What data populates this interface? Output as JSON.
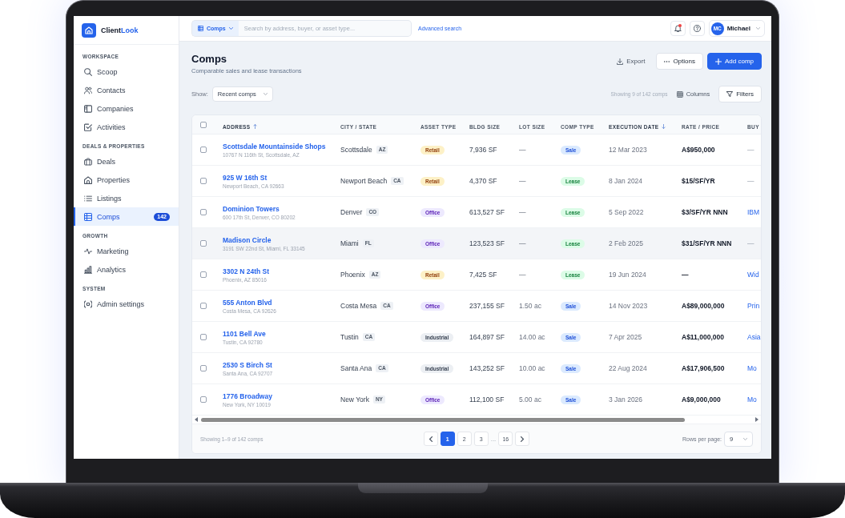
{
  "sidebar": {
    "brand": {
      "first": "Client",
      "second": "Look"
    },
    "sections": [
      {
        "title": "WORKSPACE",
        "items": [
          {
            "label": "Scoop",
            "selected": false
          },
          {
            "label": "Contacts",
            "selected": false
          },
          {
            "label": "Companies",
            "selected": false
          },
          {
            "label": "Activities",
            "selected": false
          }
        ]
      },
      {
        "title": "DEALS & PROPERTIES",
        "items": [
          {
            "label": "Deals",
            "selected": false
          },
          {
            "label": "Properties",
            "selected": false
          },
          {
            "label": "Listings",
            "selected": false
          },
          {
            "label": "Comps",
            "selected": true,
            "badge": "142"
          }
        ]
      },
      {
        "title": "GROWTH",
        "items": [
          {
            "label": "Marketing",
            "selected": false
          },
          {
            "label": "Analytics",
            "selected": false
          }
        ]
      },
      {
        "title": "SYSTEM",
        "items": [
          {
            "label": "Admin settings",
            "selected": false
          }
        ]
      }
    ]
  },
  "topbar": {
    "scope": "Comps",
    "search": {
      "placeholder": "Search by address, buyer, or asset type..."
    },
    "advanced_search": "Advanced search",
    "notifications_unread": true,
    "user": {
      "initials": "MC",
      "name": "Michael"
    }
  },
  "page": {
    "title": "Comps",
    "subtitle": "Comparable sales and lease transactions",
    "actions": [
      {
        "label": "Export",
        "kind": "link"
      },
      {
        "label": "Options",
        "kind": "secondary"
      },
      {
        "label": "Add comp",
        "kind": "primary"
      }
    ],
    "toolbar": {
      "show_label": "Show:",
      "view": "Recent comps",
      "count": "Showing 9 of 142 comps",
      "columns": "Columns",
      "filters": "Filters"
    }
  },
  "table": {
    "select_all_checked": false,
    "columns": [
      {
        "label": "ADDRESS",
        "sort_asc": true,
        "sort_desc": false
      },
      {
        "label": "CITY / STATE",
        "sort_asc": false,
        "sort_desc": false
      },
      {
        "label": "ASSET TYPE",
        "sort_asc": false,
        "sort_desc": false
      },
      {
        "label": "BLDG SIZE",
        "sort_asc": false,
        "sort_desc": false
      },
      {
        "label": "LOT SIZE",
        "sort_asc": false,
        "sort_desc": false
      },
      {
        "label": "COMP TYPE",
        "sort_asc": false,
        "sort_desc": false
      },
      {
        "label": "EXECUTION DATE",
        "sort_asc": false,
        "sort_desc": true
      },
      {
        "label": "RATE / PRICE",
        "sort_asc": false,
        "sort_desc": false
      },
      {
        "label": "BUY",
        "sort_asc": false,
        "sort_desc": false
      }
    ],
    "rows": [
      {
        "name": "Scottsdale Mountainside Shops",
        "address": "10767 N 116th St, Scottsdale, AZ",
        "city": "Scottsdale",
        "state": "AZ",
        "asset_type": {
          "label": "Retail",
          "kind": "retail"
        },
        "bldg_size": "7,936 SF",
        "lot_size": "—",
        "comp_type": {
          "label": "Sale",
          "kind": "sale"
        },
        "execution_date": "12 Mar 2023",
        "rate_price": "A$950,000",
        "buyer": {
          "text": "—",
          "link": false
        },
        "checked": false,
        "hovered": false
      },
      {
        "name": "925 W 16th St",
        "address": "Newport Beach, CA 92663",
        "city": "Newport Beach",
        "state": "CA",
        "asset_type": {
          "label": "Retail",
          "kind": "retail"
        },
        "bldg_size": "4,370 SF",
        "lot_size": "—",
        "comp_type": {
          "label": "Lease",
          "kind": "lease"
        },
        "execution_date": "8 Jan 2024",
        "rate_price": "$15/SF/YR",
        "buyer": {
          "text": "—",
          "link": false
        },
        "checked": false,
        "hovered": false
      },
      {
        "name": "Dominion Towers",
        "address": "600 17th St, Denver, CO 80202",
        "city": "Denver",
        "state": "CO",
        "asset_type": {
          "label": "Office",
          "kind": "office"
        },
        "bldg_size": "613,527 SF",
        "lot_size": "—",
        "comp_type": {
          "label": "Lease",
          "kind": "lease"
        },
        "execution_date": "5 Sep 2022",
        "rate_price": "$3/SF/YR NNN",
        "buyer": {
          "text": "IBM",
          "link": true
        },
        "checked": false,
        "hovered": false
      },
      {
        "name": "Madison Circle",
        "address": "3191 SW 22nd St, Miami, FL 33145",
        "city": "Miami",
        "state": "FL",
        "asset_type": {
          "label": "Office",
          "kind": "office"
        },
        "bldg_size": "123,523 SF",
        "lot_size": "—",
        "comp_type": {
          "label": "Lease",
          "kind": "lease"
        },
        "execution_date": "2 Feb 2025",
        "rate_price": "$31/SF/YR NNN",
        "buyer": {
          "text": "—",
          "link": false
        },
        "checked": false,
        "hovered": true
      },
      {
        "name": "3302 N 24th St",
        "address": "Phoenix, AZ 85016",
        "city": "Phoenix",
        "state": "AZ",
        "asset_type": {
          "label": "Retail",
          "kind": "retail"
        },
        "bldg_size": "7,425 SF",
        "lot_size": "—",
        "comp_type": {
          "label": "Lease",
          "kind": "lease"
        },
        "execution_date": "19 Jun 2024",
        "rate_price": "—",
        "buyer": {
          "text": "Wid",
          "link": true
        },
        "checked": false,
        "hovered": false
      },
      {
        "name": "555 Anton Blvd",
        "address": "Costa Mesa, CA 92626",
        "city": "Costa Mesa",
        "state": "CA",
        "asset_type": {
          "label": "Office",
          "kind": "office"
        },
        "bldg_size": "237,155 SF",
        "lot_size": "1.50 ac",
        "comp_type": {
          "label": "Sale",
          "kind": "sale"
        },
        "execution_date": "14 Nov 2023",
        "rate_price": "A$89,000,000",
        "buyer": {
          "text": "Prin",
          "link": true
        },
        "checked": false,
        "hovered": false
      },
      {
        "name": "1101 Bell Ave",
        "address": "Tustin, CA 92780",
        "city": "Tustin",
        "state": "CA",
        "asset_type": {
          "label": "Industrial",
          "kind": "industrial"
        },
        "bldg_size": "164,897 SF",
        "lot_size": "14.00 ac",
        "comp_type": {
          "label": "Sale",
          "kind": "sale"
        },
        "execution_date": "7 Apr 2025",
        "rate_price": "A$11,000,000",
        "buyer": {
          "text": "Asia",
          "link": true
        },
        "checked": false,
        "hovered": false
      },
      {
        "name": "2530 S Birch St",
        "address": "Santa Ana, CA 92707",
        "city": "Santa Ana",
        "state": "CA",
        "asset_type": {
          "label": "Industrial",
          "kind": "industrial"
        },
        "bldg_size": "143,252 SF",
        "lot_size": "10.00 ac",
        "comp_type": {
          "label": "Sale",
          "kind": "sale"
        },
        "execution_date": "22 Aug 2024",
        "rate_price": "A$17,906,500",
        "buyer": {
          "text": "Mo",
          "link": true
        },
        "checked": false,
        "hovered": false
      },
      {
        "name": "1776 Broadway",
        "address": "New York, NY 10019",
        "city": "New York",
        "state": "NY",
        "asset_type": {
          "label": "Office",
          "kind": "office"
        },
        "bldg_size": "112,100 SF",
        "lot_size": "5.00 ac",
        "comp_type": {
          "label": "Sale",
          "kind": "sale"
        },
        "execution_date": "3 Jan 2026",
        "rate_price": "A$9,000,000",
        "buyer": {
          "text": "Mo",
          "link": true
        },
        "checked": false,
        "hovered": false
      }
    ],
    "footer": {
      "summary": "Showing 1–9 of 142 comps",
      "pages": [
        {
          "label": "1",
          "kind": "page",
          "selected": true
        },
        {
          "label": "2",
          "kind": "page",
          "selected": false
        },
        {
          "label": "3",
          "kind": "page",
          "selected": false
        },
        {
          "label": "...",
          "kind": "gap"
        },
        {
          "label": "16",
          "kind": "page",
          "selected": false
        }
      ],
      "rows_per_page_label": "Rows per page:",
      "rows_per_page": "9"
    }
  }
}
